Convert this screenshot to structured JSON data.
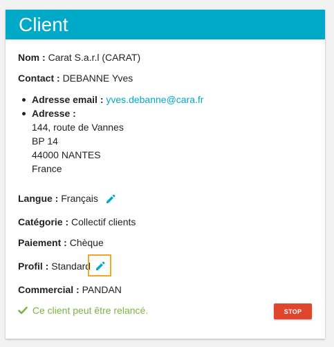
{
  "card": {
    "title": "Client"
  },
  "nom": {
    "label": "Nom :",
    "value": "Carat S.a.r.l (CARAT)"
  },
  "contact": {
    "label": "Contact :",
    "value": "DEBANNE Yves"
  },
  "email": {
    "label": "Adresse email :",
    "value": "yves.debanne@cara.fr"
  },
  "adresse": {
    "label": "Adresse :",
    "lines": [
      "144, route de Vannes",
      "BP 14",
      "44000 NANTES",
      "France"
    ]
  },
  "langue": {
    "label": "Langue :",
    "value": "Français",
    "edit_icon": "pencil-icon"
  },
  "categorie": {
    "label": "Catégorie :",
    "value": "Collectif clients"
  },
  "paiement": {
    "label": "Paiement :",
    "value": "Chèque"
  },
  "profil": {
    "label": "Profil :",
    "value": "Standard",
    "edit_icon": "pencil-icon"
  },
  "commercial": {
    "label": "Commercial :",
    "value": "PANDAN"
  },
  "status": {
    "icon": "check-icon",
    "text": "Ce client peut être relancé."
  },
  "actions": {
    "stop_label": "STOP"
  },
  "colors": {
    "header": "#00a9c8",
    "link": "#00a9c8",
    "success": "#7cb342",
    "stop": "#e0452e",
    "highlight": "#f5a623"
  }
}
